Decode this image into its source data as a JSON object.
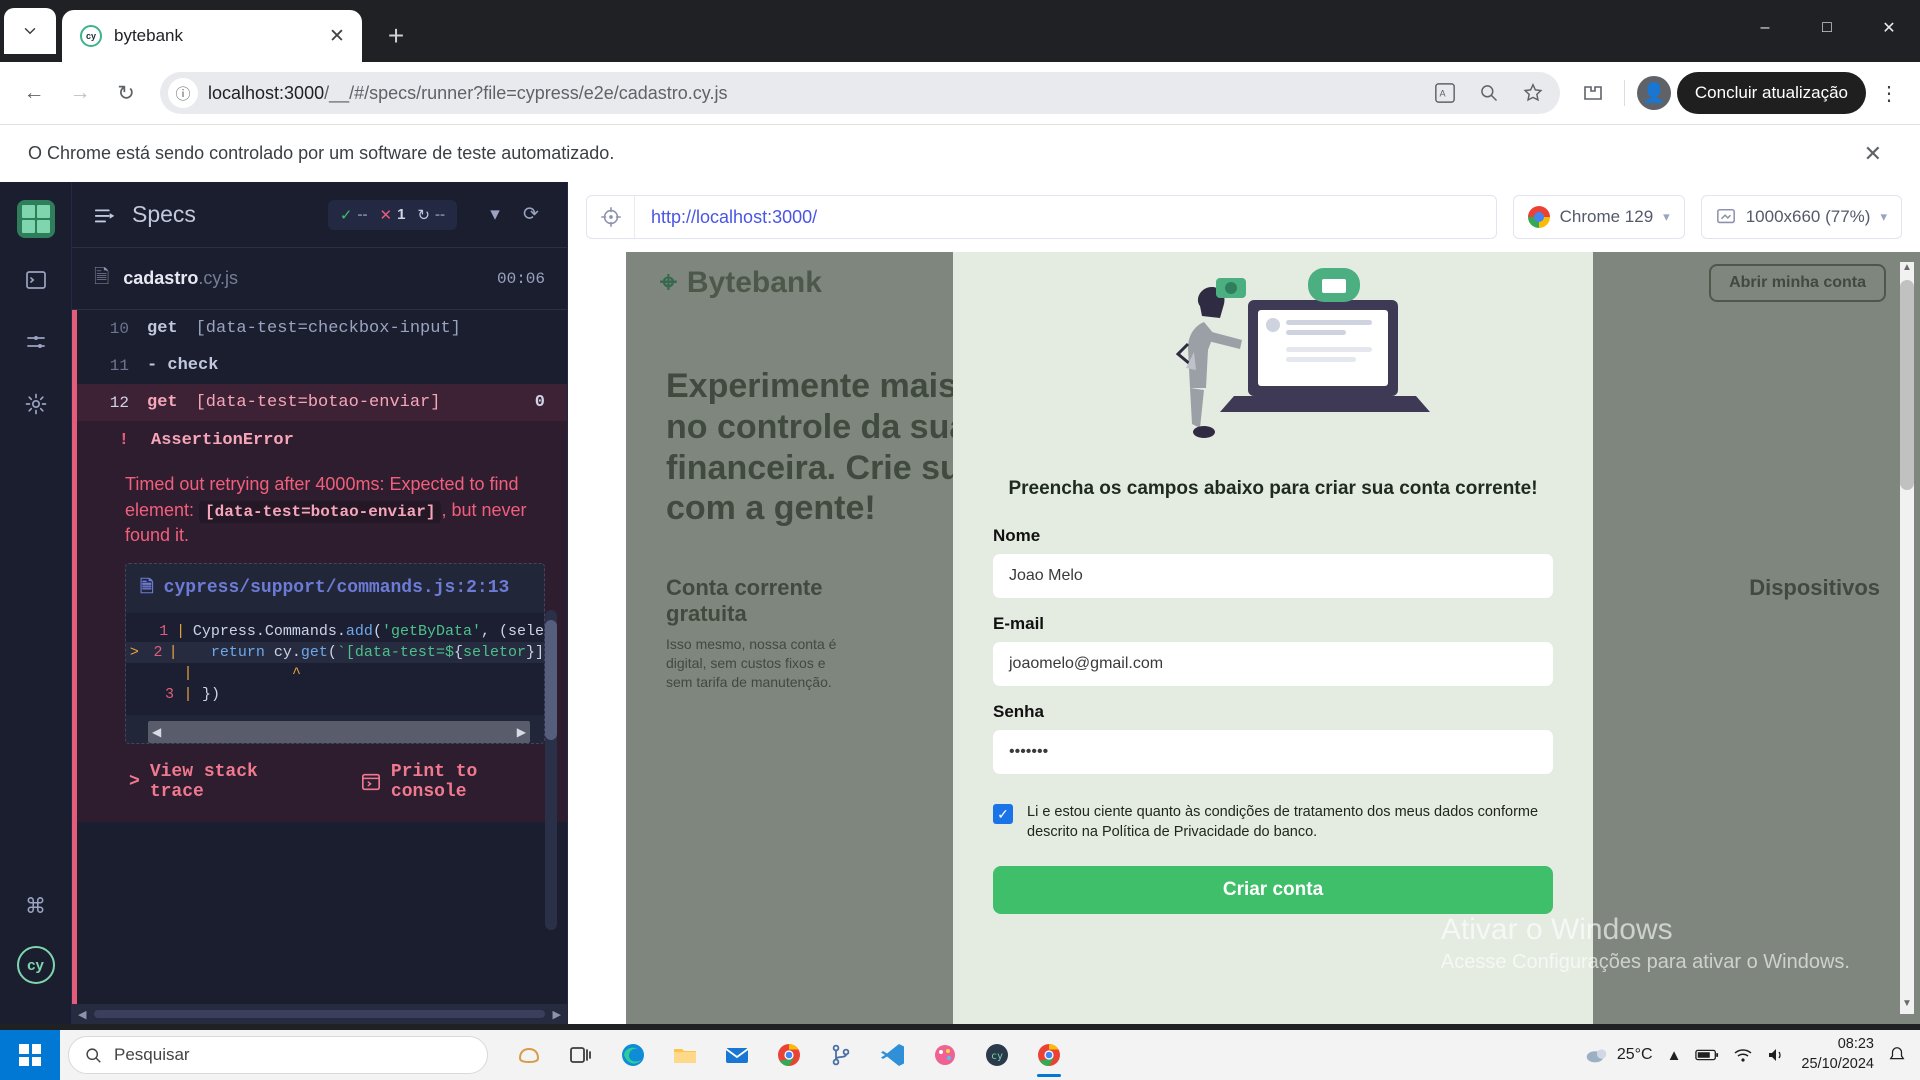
{
  "browser": {
    "tab": {
      "title": "bytebank",
      "favicon_label": "cy",
      "close_icon": "close-icon"
    },
    "new_tab_label": "+",
    "window_controls": {
      "minimize": "–",
      "maximize": "□",
      "close": "✕"
    },
    "nav": {
      "back": "←",
      "forward": "→",
      "reload": "↻"
    },
    "url": {
      "info_icon": "info-icon",
      "host": "localhost:3000",
      "path": "/__/#/specs/runner?file=cypress/e2e/cadastro.cy.js",
      "full": "localhost:3000/__/#/specs/runner?file=cypress/e2e/cadastro.cy.js"
    },
    "omni_actions": [
      "translate-icon",
      "zoom-icon",
      "bookmark-star-icon"
    ],
    "extensions_icon": "extensions-icon",
    "profile_icon": "profile-avatar-icon",
    "update_button": "Concluir atualização",
    "menu_icon": "kebab-menu-icon",
    "infobar": {
      "message": "O Chrome está sendo controlado por um software de teste automatizado.",
      "close_icon": "close-icon"
    }
  },
  "cypress": {
    "rail": {
      "logo": "cypress-logo-icon",
      "items": [
        "specs-icon",
        "runs-icon",
        "settings-icon"
      ],
      "shortcut_icon": "keyboard-shortcut-icon",
      "badge": "cy"
    },
    "reporter": {
      "header_title": "Specs",
      "header_icon": "specs-list-icon",
      "stats": {
        "passed_icon": "check-icon",
        "passed": "--",
        "failed_icon": "times-icon",
        "failed": "1",
        "pending_icon": "circle-dashed-icon",
        "pending": "--"
      },
      "collapse_icon": "chevron-down-icon",
      "restart_icon": "restart-icon",
      "spec": {
        "file_icon": "file-icon",
        "name": "cadastro",
        "ext": ".cy.js",
        "duration": "00:06"
      },
      "commands": [
        {
          "num": "10",
          "kw": "get",
          "arg": "[data-test=checkbox-input]",
          "state": "ok",
          "count": ""
        },
        {
          "num": "11",
          "kw": "- check",
          "arg": "",
          "state": "ok",
          "count": ""
        },
        {
          "num": "12",
          "kw": "get",
          "arg": "[data-test=botao-enviar]",
          "state": "failed",
          "count": "0"
        }
      ],
      "error": {
        "bang": "!",
        "name": "AssertionError",
        "message_pre": "Timed out retrying after 4000ms: Expected to find element: ",
        "message_code": "[data-test=botao-enviar]",
        "message_post": ", but never found it.",
        "code_file": "cypress/support/commands.js:2:13",
        "code_file_icon": "file-icon",
        "code_lines": [
          {
            "caret": "",
            "num": "1",
            "text": "Cypress.Commands.add('getByData', (sele"
          },
          {
            "caret": ">",
            "num": "2",
            "text": "  return cy.get(`[data-test=${seletor}]"
          },
          {
            "caret": "",
            "num": "",
            "text": "              ^"
          },
          {
            "caret": "",
            "num": "3",
            "text": "})"
          }
        ],
        "actions": {
          "stack_trace": "View stack trace",
          "stack_trace_icon": "chevron-right-icon",
          "print_console": "Print to console",
          "print_console_icon": "console-icon"
        }
      }
    },
    "aut": {
      "url": "http://localhost:3000/",
      "url_icon": "selector-playground-icon",
      "browser_label": "Chrome 129",
      "browser_icon": "chrome-icon",
      "viewport_label": "1000x660 (77%)",
      "viewport_icon": "viewport-icon",
      "chevron_icon": "chevron-down-icon"
    }
  },
  "bytebank": {
    "logo": "Bytebank",
    "nav_buttons": [
      "Abrir minha conta"
    ],
    "hero_lines": [
      "Experimente mais liberdade",
      "no controle da sua vida",
      "financeira. Crie sua conta",
      "com a gente!"
    ],
    "cards": [
      {
        "title": "Conta corrente",
        "title2": "gratuita",
        "body": "Isso mesmo, nossa conta é digital, sem custos fixos e sem tarifa de manutenção."
      },
      {
        "title": "Dispositivos",
        "body": ""
      }
    ],
    "modal": {
      "subtitle": "Preencha os campos abaixo para criar sua conta corrente!",
      "fields": [
        {
          "label": "Nome",
          "value": "Joao Melo",
          "name": "nome"
        },
        {
          "label": "E-mail",
          "value": "joaomelo@gmail.com",
          "name": "email"
        },
        {
          "label": "Senha",
          "value": "•••••••",
          "name": "senha"
        }
      ],
      "checkbox": {
        "checked": true,
        "check_glyph": "✓",
        "text": "Li e estou ciente quanto às condições de tratamento dos meus dados conforme descrito na Política de Privacidade do banco."
      },
      "submit": "Criar conta"
    }
  },
  "windows_watermark": {
    "line1": "Ativar o Windows",
    "line2": "Acesse Configurações para ativar o Windows."
  },
  "taskbar": {
    "start_icon": "windows-start-icon",
    "search_placeholder": "Pesquisar",
    "search_icon": "search-icon",
    "pinned": [
      "copilot-icon",
      "task-view-icon",
      "edge-icon",
      "file-explorer-icon",
      "mail-icon",
      "chrome-icon",
      "git-icon",
      "vscode-icon",
      "paint-icon",
      "cypress-icon",
      "chrome-active-icon"
    ],
    "tray": {
      "weather_icon": "weather-icon",
      "temperature": "25°C",
      "overflow_icon": "chevron-up-icon",
      "battery_icon": "battery-icon",
      "wifi_icon": "wifi-icon",
      "volume_icon": "volume-icon",
      "time": "08:23",
      "date": "25/10/2024",
      "notifications_icon": "notifications-icon"
    }
  },
  "colors": {
    "cypress_bg": "#1b1e2e",
    "fail_red": "#e45c7a",
    "pass_green": "#3fbf6a",
    "accent_blue": "#1a73e8",
    "bytebank_green": "#e8f0e6"
  }
}
